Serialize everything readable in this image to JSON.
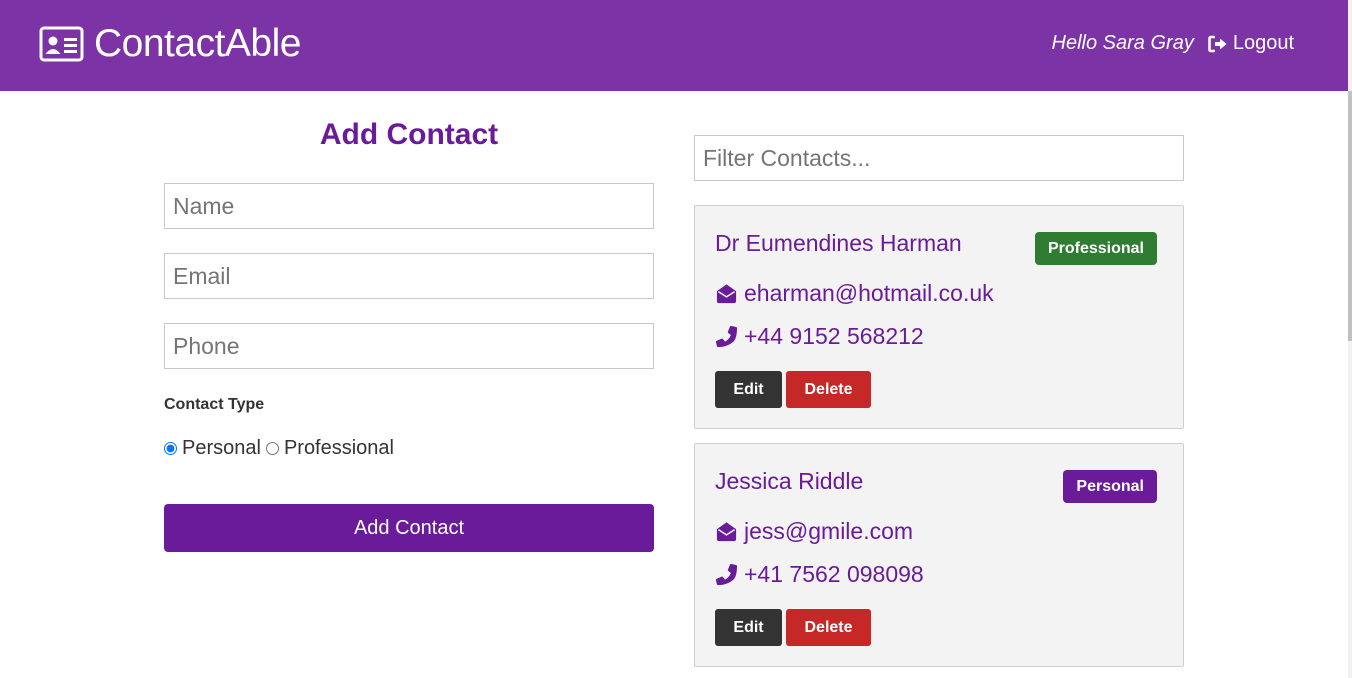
{
  "colors": {
    "navbar": "#7b33a6",
    "primary": "#6a1b9a",
    "professional_badge": "#2e7d32",
    "personal_badge": "#6a1b9a",
    "edit_button": "#333333",
    "delete_button": "#c62828",
    "card_background": "#f3f3f3"
  },
  "header": {
    "brand_icon": "id-card-icon",
    "brand": "ContactAble",
    "greeting": "Hello Sara Gray",
    "logout_icon": "sign-out-icon",
    "logout_label": "Logout"
  },
  "form": {
    "title": "Add Contact",
    "name_placeholder": "Name",
    "email_placeholder": "Email",
    "phone_placeholder": "Phone",
    "contact_type_label": "Contact Type",
    "personal_label": "Personal",
    "professional_label": "Professional",
    "selected_type": "Personal",
    "submit_label": "Add Contact"
  },
  "filter": {
    "placeholder": "Filter Contacts..."
  },
  "contacts": [
    {
      "name": "Dr Eumendines Harman",
      "type": "Professional",
      "email_icon": "envelope-open-icon",
      "email": "eharman@hotmail.co.uk",
      "phone_icon": "phone-icon",
      "phone": "+44 9152 568212",
      "edit_label": "Edit",
      "delete_label": "Delete"
    },
    {
      "name": "Jessica Riddle",
      "type": "Personal",
      "email_icon": "envelope-open-icon",
      "email": "jess@gmile.com",
      "phone_icon": "phone-icon",
      "phone": "+41 7562 098098",
      "edit_label": "Edit",
      "delete_label": "Delete"
    }
  ]
}
